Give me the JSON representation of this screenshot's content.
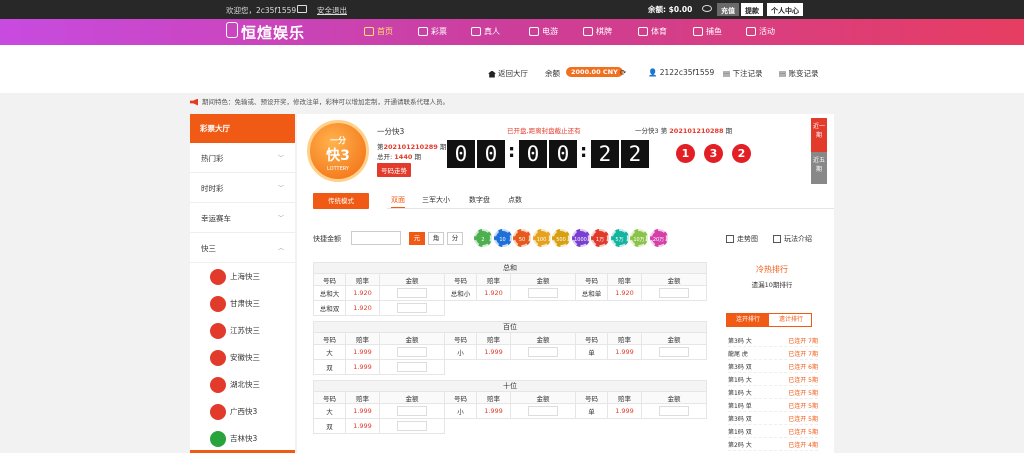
{
  "topbar": {
    "welcome": "欢迎您，2c35f1559",
    "logout": "安全退出",
    "balance": "余额: $0.00",
    "recharge": "充值",
    "withdraw": "提款",
    "user_center": "个人中心"
  },
  "nav": {
    "logo": "恒煊娱乐",
    "items": [
      {
        "label": "首页",
        "icon": "home-icon"
      },
      {
        "label": "彩票",
        "icon": "ticket-icon"
      },
      {
        "label": "真人",
        "icon": "person-icon"
      },
      {
        "label": "电游",
        "icon": "gamepad-icon"
      },
      {
        "label": "棋牌",
        "icon": "dice-icon"
      },
      {
        "label": "体育",
        "icon": "ball-icon"
      },
      {
        "label": "捕鱼",
        "icon": "fish-icon"
      },
      {
        "label": "活动",
        "icon": "gift-icon"
      }
    ]
  },
  "subheader": {
    "lobby": "返回大厅",
    "balance_label": "余额",
    "balance_value": "2000.00 CNY",
    "username": "2122c35f1559",
    "bet_record": "下注记录",
    "account_record": "账变记录"
  },
  "notice": "期间特色：免输或、预设开奖，修改注单，彩种可以增加定制，开通请联系代理人员。",
  "sidebar": {
    "header": "彩票大厅",
    "categories": [
      "热门彩",
      "时时彩",
      "幸运赛车",
      "快三"
    ],
    "subitems": [
      "上海快三",
      "甘肃快三",
      "江苏快三",
      "安徽快三",
      "湖北快三",
      "广西快3",
      "吉林快3"
    ]
  },
  "lottery": {
    "logo_top": "一分",
    "logo_mid": "快3",
    "logo_bottom": "LOTTERY",
    "name": "一分快3",
    "issue_prefix": "第",
    "issue_no": "202101210289",
    "issue_suffix": "期",
    "total_prefix": "总开:",
    "total_value": "1440",
    "total_suffix": "期",
    "trend_btn": "号码走势",
    "status": "已开盘,距离封盘截止还有",
    "countdown": [
      "00",
      "00",
      "22"
    ],
    "last_prefix": "一分快3 第",
    "last_issue": "202101210288",
    "last_suffix": "期",
    "result": [
      "1",
      "3",
      "2"
    ],
    "tab_recent": "近一期",
    "tab_recent10": "近五期"
  },
  "play": {
    "mode_btn": "传统模式",
    "tabs": [
      "双面",
      "三军大小",
      "数字盘",
      "点数"
    ],
    "quick_label": "快捷金额",
    "units": [
      "元",
      "角",
      "分"
    ],
    "chips": [
      {
        "label": "2",
        "color": "#4caf50"
      },
      {
        "label": "10",
        "color": "#1e6fd9"
      },
      {
        "label": "50",
        "color": "#e65a1e"
      },
      {
        "label": "100",
        "color": "#e6a21e"
      },
      {
        "label": "500",
        "color": "#d6a010"
      },
      {
        "label": "1000",
        "color": "#7a3fd1"
      },
      {
        "label": "1万",
        "color": "#e03a2b"
      },
      {
        "label": "5万",
        "color": "#14b4a0"
      },
      {
        "label": "10万",
        "color": "#8bc34a"
      },
      {
        "label": "20万",
        "color": "#d43fa8"
      }
    ],
    "trend_link": "走势图",
    "rules_link": "玩法介绍"
  },
  "bet_table": {
    "headers": {
      "num": "号码",
      "odds": "赔率",
      "amount": "金额"
    },
    "sections": [
      {
        "title": "总和",
        "rows": [
          [
            [
              "总和大",
              "1.920"
            ],
            [
              "总和小",
              "1.920"
            ],
            [
              "总和单",
              "1.920"
            ]
          ],
          [
            [
              "总和双",
              "1.920"
            ]
          ]
        ]
      },
      {
        "title": "百位",
        "rows": [
          [
            [
              "大",
              "1.999"
            ],
            [
              "小",
              "1.999"
            ],
            [
              "单",
              "1.999"
            ]
          ],
          [
            [
              "双",
              "1.999"
            ]
          ]
        ]
      },
      {
        "title": "十位",
        "rows": [
          [
            [
              "大",
              "1.999"
            ],
            [
              "小",
              "1.999"
            ],
            [
              "单",
              "1.999"
            ]
          ],
          [
            [
              "双",
              "1.999"
            ]
          ]
        ]
      }
    ]
  },
  "hot": {
    "title": "冷热排行",
    "subtitle": "遗漏10期排行",
    "tabs": [
      "连开排行",
      "遗计排行"
    ],
    "rows": [
      [
        "第3码 大",
        "已连开 7期"
      ],
      [
        "龍尾 虎",
        "已连开 7期"
      ],
      [
        "第3码 双",
        "已连开 6期"
      ],
      [
        "第1码 大",
        "已连开 5期"
      ],
      [
        "第1码 大",
        "已连开 5期"
      ],
      [
        "第1码 单",
        "已连开 5期"
      ],
      [
        "第3码 双",
        "已连开 5期"
      ],
      [
        "第1码 双",
        "已连开 5期"
      ],
      [
        "第2码 大",
        "已连开 4期"
      ]
    ]
  }
}
